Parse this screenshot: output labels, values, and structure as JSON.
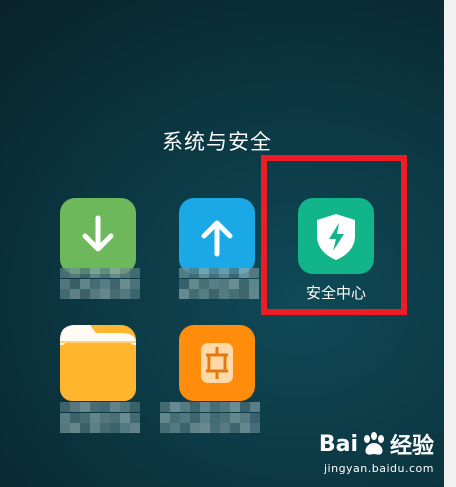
{
  "folder": {
    "title": "系统与安全",
    "apps": [
      {
        "id": "download",
        "label": "",
        "icon": "download-arrow-icon",
        "color": "#6cb85a"
      },
      {
        "id": "upload",
        "label": "",
        "icon": "upload-arrow-icon",
        "color": "#1aa8e6"
      },
      {
        "id": "security-center",
        "label": "安全中心",
        "icon": "shield-lightning-icon",
        "color": "#12b48a"
      },
      {
        "id": "files",
        "label": "",
        "icon": "folder-icon",
        "color": "#ffb52e"
      },
      {
        "id": "sim",
        "label": "",
        "icon": "sim-card-icon",
        "color": "#ff8c0a"
      }
    ]
  },
  "watermark": {
    "brand_prefix": "Bai",
    "brand_suffix": "经验",
    "url": "jingyan.baidu.com"
  },
  "colors": {
    "highlight": "#ee1c24"
  }
}
